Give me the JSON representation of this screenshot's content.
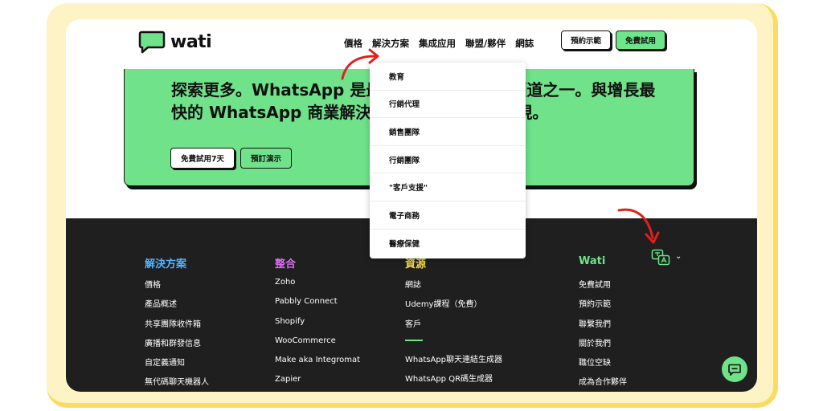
{
  "brand": {
    "name": "wati"
  },
  "nav": {
    "items": [
      "價格",
      "解決方案",
      "集成应用",
      "聯盟/夥伴",
      "網誌"
    ],
    "demo_button": "預約示範",
    "free_trial_button": "免費試用"
  },
  "hero": {
    "headline": "探索更多。WhatsApp 是最受歡迎的訊息傳遞頻道之一。與增長最快的 WhatsApp 商業解決方案合作，將流量變現。",
    "trial_button": "免費試用7天",
    "demo_button": "預訂演示"
  },
  "dropdown": {
    "items": [
      "教育",
      "行銷代理",
      "銷售團隊",
      "行銷團隊",
      "\"客戶支援\"",
      "電子商務",
      "醫療保健"
    ]
  },
  "footer": {
    "columns": [
      {
        "title": "解決方案",
        "color": "#55b3ff",
        "links": [
          "價格",
          "產品概述",
          "共享團隊收件箱",
          "廣播和群發信息",
          "自定義通知",
          "無代碼聊天機器人"
        ]
      },
      {
        "title": "整合",
        "color": "#d86cf0",
        "links": [
          "Zoho",
          "Pabbly Connect",
          "Shopify",
          "WooCommerce",
          "Make aka Integromat",
          "Zapier"
        ]
      },
      {
        "title": "資源",
        "color": "#f3d94a",
        "links": [
          "網誌",
          "Udemy課程（免費）",
          "客戶"
        ],
        "links_after_divider": [
          "WhatsApp聊天連結生成器",
          "WhatsApp QR碼生成器"
        ]
      },
      {
        "title": "Wati",
        "color": "#6ee58a",
        "links": [
          "免費試用",
          "預約示範",
          "聯繫我們",
          "關於我們",
          "職位空缺",
          "成為合作夥伴"
        ]
      }
    ]
  },
  "colors": {
    "accent_green": "#6fe28a",
    "footer_bg": "#1f1f1f",
    "frame_yellow": "#fdf3c4",
    "annotation_red": "#e0201b"
  },
  "icons": {
    "logo": "chat-bubble-icon",
    "language": "translate-icon",
    "chat": "chat-icon",
    "chevron": "chevron-down-icon"
  }
}
